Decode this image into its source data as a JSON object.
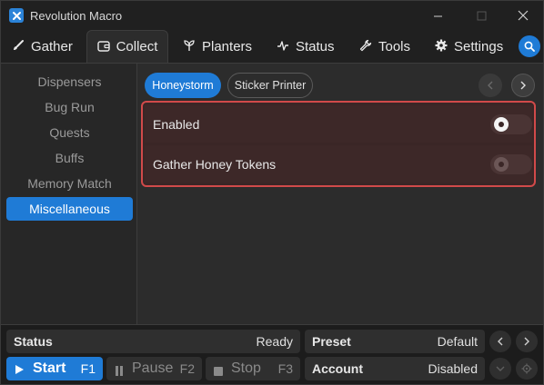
{
  "app": {
    "title": "Revolution Macro"
  },
  "tabs": [
    {
      "label": "Gather",
      "icon": "brush-icon"
    },
    {
      "label": "Collect",
      "icon": "wallet-icon",
      "active": true
    },
    {
      "label": "Planters",
      "icon": "sprout-icon"
    },
    {
      "label": "Status",
      "icon": "pulse-icon"
    },
    {
      "label": "Tools",
      "icon": "wrench-icon"
    },
    {
      "label": "Settings",
      "icon": "gear-icon"
    }
  ],
  "sidebar": {
    "items": [
      {
        "label": "Dispensers"
      },
      {
        "label": "Bug Run"
      },
      {
        "label": "Quests"
      },
      {
        "label": "Buffs"
      },
      {
        "label": "Memory Match"
      },
      {
        "label": "Miscellaneous",
        "active": true
      }
    ]
  },
  "subtabs": [
    {
      "label": "Honeystorm",
      "active": true
    },
    {
      "label": "Sticker Printer"
    }
  ],
  "settings": [
    {
      "label": "Enabled",
      "on": true
    },
    {
      "label": "Gather Honey Tokens",
      "on": false
    }
  ],
  "bottom": {
    "status": {
      "label": "Status",
      "value": "Ready"
    },
    "preset": {
      "label": "Preset",
      "value": "Default"
    },
    "account": {
      "label": "Account",
      "value": "Disabled"
    },
    "start": {
      "label": "Start",
      "key": "F1"
    },
    "pause": {
      "label": "Pause",
      "key": "F2"
    },
    "stop": {
      "label": "Stop",
      "key": "F3"
    }
  },
  "colors": {
    "accent": "#1f7bd6",
    "highlight_border": "#d14a4a"
  }
}
